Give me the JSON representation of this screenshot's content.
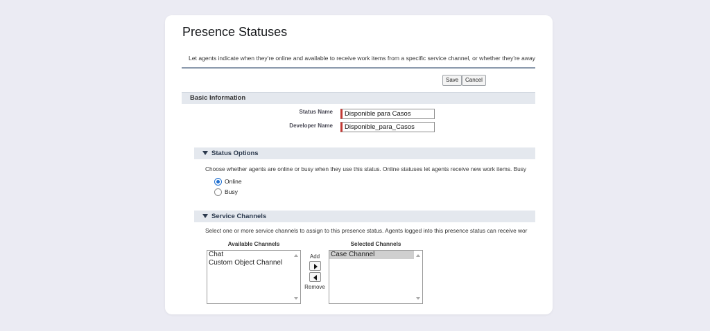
{
  "page": {
    "title": "Presence Statuses",
    "description": "Let agents indicate when they're online and available to receive work items from a specific service channel, or whether they're away"
  },
  "toolbar": {
    "save_label": "Save",
    "cancel_label": "Cancel"
  },
  "basic_info": {
    "heading": "Basic Information",
    "status_name_label": "Status Name",
    "status_name_value": "Disponible para Casos",
    "developer_name_label": "Developer Name",
    "developer_name_value": "Disponible_para_Casos"
  },
  "status_options": {
    "heading": "Status Options",
    "help": "Choose whether agents are online or busy when they use this status. Online statuses let agents receive new work items. Busy",
    "options": [
      {
        "label": "Online",
        "selected": true
      },
      {
        "label": "Busy",
        "selected": false
      }
    ]
  },
  "service_channels": {
    "heading": "Service Channels",
    "help": "Select one or more service channels to assign to this presence status. Agents logged into this presence status can receive wor",
    "available_label": "Available Channels",
    "selected_label": "Selected Channels",
    "available": [
      "Chat",
      "Custom Object Channel"
    ],
    "selected": [
      "Case Channel"
    ],
    "add_label": "Add",
    "remove_label": "Remove"
  },
  "colors": {
    "background": "#ebebf3",
    "section_header": "#e4e8ee",
    "required_marker": "#c23934",
    "radio_selected": "#1f6fd0"
  }
}
